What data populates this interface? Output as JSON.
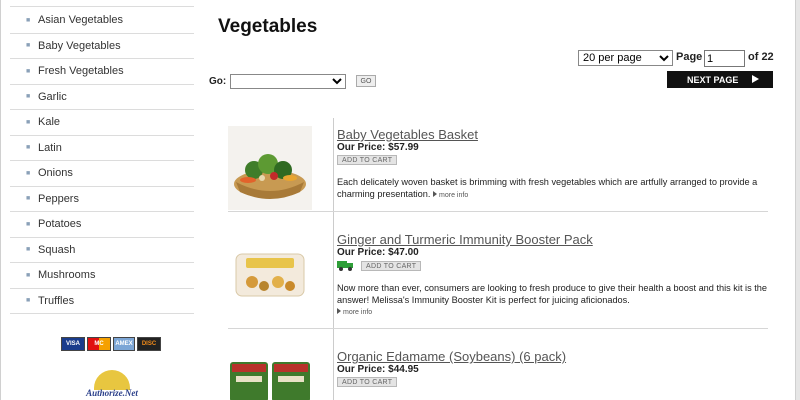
{
  "sidebar": {
    "items": [
      {
        "label": "Asian Vegetables"
      },
      {
        "label": "Baby Vegetables"
      },
      {
        "label": "Fresh Vegetables"
      },
      {
        "label": "Garlic"
      },
      {
        "label": "Kale"
      },
      {
        "label": "Latin"
      },
      {
        "label": "Onions"
      },
      {
        "label": "Peppers"
      },
      {
        "label": "Potatoes"
      },
      {
        "label": "Squash"
      },
      {
        "label": "Mushrooms"
      },
      {
        "label": "Truffles"
      }
    ],
    "payment_cards": [
      "VISA",
      "MC",
      "AMEX",
      "DISC"
    ],
    "authorize_net_label": "Authorize.Net"
  },
  "main": {
    "title": "Vegetables",
    "pagination": {
      "per_page": "20 per page",
      "page_label": "Page",
      "page_value": "1",
      "of_label": "of 22",
      "next_label": "NEXT PAGE"
    },
    "go": {
      "label": "Go:",
      "select_value": "",
      "button_label": "GO"
    },
    "products": [
      {
        "name": "Baby Vegetables Basket",
        "price": "Our Price: $57.99",
        "cart_label": "ADD TO CART",
        "description": "Each delicately woven basket is brimming with fresh vegetables which are artfully arranged to provide a charming presentation.",
        "more_label": "more info"
      },
      {
        "name": "Ginger and Turmeric Immunity Booster Pack",
        "price": "Our Price: $47.00",
        "cart_label": "ADD TO CART",
        "description": "Now more than ever, consumers are looking to fresh produce to give their health a boost and this kit is the answer! Melissa's Immunity Booster Kit is perfect for juicing aficionados.",
        "more_label": "more info"
      },
      {
        "name": "Organic Edamame (Soybeans) (6 pack)",
        "price": "Our Price: $44.95",
        "cart_label": "ADD TO CART",
        "description": "",
        "more_label": ""
      }
    ]
  },
  "colors": {
    "next_button_bg": "#111111",
    "truck_green": "#2e9e38",
    "bullet": "#8aa0b8"
  },
  "icons": {
    "sidebar_bullet": "bullet-icon",
    "next_arrow": "play-arrow-icon",
    "shipping": "truck-icon",
    "more_info": "triangle-right-icon"
  }
}
